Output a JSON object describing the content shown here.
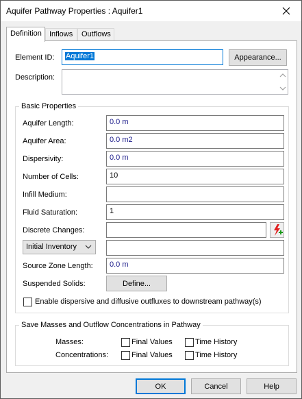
{
  "window": {
    "title": "Aquifer Pathway Properties : Aquifer1"
  },
  "tabs": [
    {
      "label": "Definition"
    },
    {
      "label": "Inflows"
    },
    {
      "label": "Outflows"
    }
  ],
  "definition": {
    "element_id_label": "Element ID:",
    "element_id_value": "Aquifer1",
    "appearance_button": "Appearance...",
    "description_label": "Description:",
    "description_value": "",
    "basic_properties": {
      "title": "Basic Properties",
      "aquifer_length_label": "Aquifer Length:",
      "aquifer_length_value": "0.0 m",
      "aquifer_area_label": "Aquifer Area:",
      "aquifer_area_value": "0.0 m2",
      "dispersivity_label": "Dispersivity:",
      "dispersivity_value": "0.0 m",
      "number_of_cells_label": "Number of Cells:",
      "number_of_cells_value": "10",
      "infill_medium_label": "Infill Medium:",
      "infill_medium_value": "",
      "fluid_saturation_label": "Fluid Saturation:",
      "fluid_saturation_value": "1",
      "discrete_changes_label": "Discrete Changes:",
      "discrete_changes_value": "",
      "inventory_select": "Initial Inventory",
      "inventory_value": "",
      "source_zone_length_label": "Source Zone Length:",
      "source_zone_length_value": "0.0 m",
      "suspended_solids_label": "Suspended Solids:",
      "define_button": "Define...",
      "enable_outfluxes_label": "Enable dispersive and diffusive outfluxes to downstream pathway(s)",
      "enable_outfluxes_checked": false
    },
    "save_group": {
      "title": "Save Masses and Outflow Concentrations in Pathway",
      "masses_label": "Masses:",
      "concentrations_label": "Concentrations:",
      "final_values_label": "Final Values",
      "time_history_label": "Time History",
      "masses_final_checked": false,
      "masses_history_checked": false,
      "conc_final_checked": false,
      "conc_history_checked": false
    }
  },
  "footer": {
    "ok": "OK",
    "cancel": "Cancel",
    "help": "Help"
  },
  "colors": {
    "accent": "#0078d7",
    "value_text": "#1a1a8a",
    "lightning": "#e02020"
  }
}
